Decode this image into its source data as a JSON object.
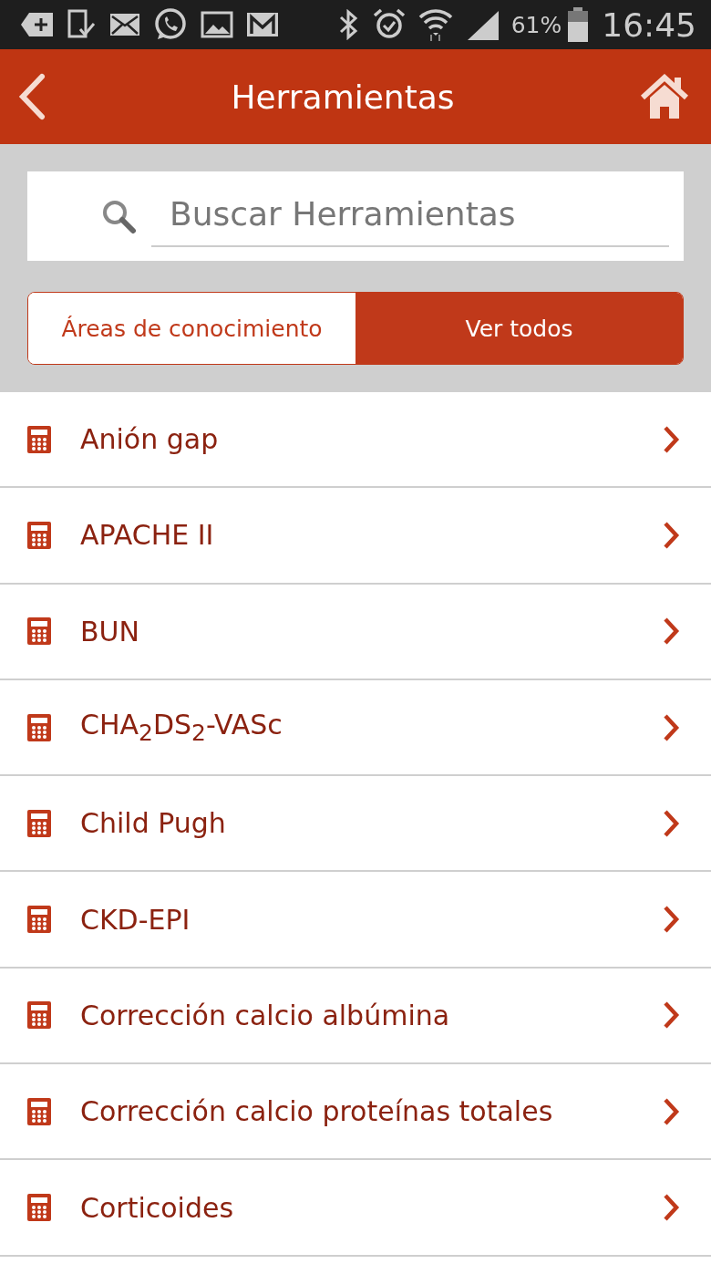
{
  "status_bar": {
    "battery": "61%",
    "time": "16:45"
  },
  "header": {
    "title": "Herramientas"
  },
  "search": {
    "placeholder": "Buscar Herramientas"
  },
  "tabs": [
    {
      "label": "Áreas de conocimiento",
      "selected": false
    },
    {
      "label": "Ver todos",
      "selected": true
    }
  ],
  "tools": [
    {
      "label": "Anión gap"
    },
    {
      "label": "APACHE II"
    },
    {
      "label": "BUN"
    },
    {
      "label": "CHA$_{2}$DS$_{2}$-VASc"
    },
    {
      "label": "Child Pugh"
    },
    {
      "label": "CKD-EPI"
    },
    {
      "label": "Corrección calcio albúmina"
    },
    {
      "label": "Corrección calcio proteínas totales"
    },
    {
      "label": "Corticoides"
    }
  ]
}
